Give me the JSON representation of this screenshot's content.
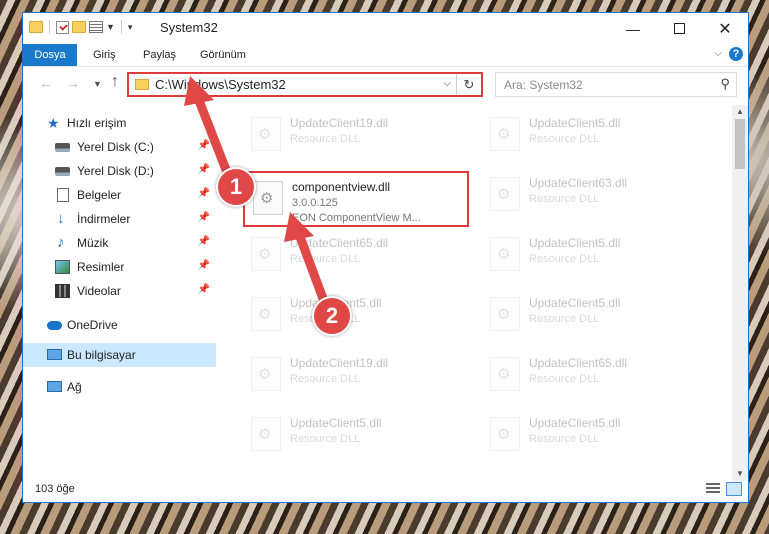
{
  "window": {
    "title": "System32",
    "minimize": "—",
    "close": "✕"
  },
  "ribbon": {
    "tabs": [
      "Dosya",
      "Giriş",
      "Paylaş",
      "Görünüm"
    ],
    "help": "?"
  },
  "navigation": {
    "address": "C:\\Windows\\System32",
    "search_placeholder": "Ara: System32"
  },
  "sidebar": {
    "items": [
      {
        "label": "Hızlı erişim",
        "icon": "star-icon",
        "pinned": false
      },
      {
        "label": "Yerel Disk (C:)",
        "icon": "drive-icon",
        "pinned": true
      },
      {
        "label": "Yerel Disk (D:)",
        "icon": "drive-icon",
        "pinned": true
      },
      {
        "label": "Belgeler",
        "icon": "document-icon",
        "pinned": true
      },
      {
        "label": "İndirmeler",
        "icon": "download-icon",
        "pinned": true
      },
      {
        "label": "Müzik",
        "icon": "music-icon",
        "pinned": true
      },
      {
        "label": "Resimler",
        "icon": "pictures-icon",
        "pinned": true
      },
      {
        "label": "Videolar",
        "icon": "videos-icon",
        "pinned": true
      },
      {
        "label": "OneDrive",
        "icon": "cloud-icon",
        "pinned": false
      },
      {
        "label": "Bu bilgisayar",
        "icon": "computer-icon",
        "pinned": false,
        "selected": true
      },
      {
        "label": "Ağ",
        "icon": "network-icon",
        "pinned": false
      }
    ]
  },
  "files": {
    "highlighted": {
      "name": "componentview.dll",
      "version": "3.0.0.125",
      "description": "EON ComponentView M..."
    },
    "left_column": [
      {
        "name": "UpdateClient19.dll",
        "desc": "Resource DLL"
      },
      {
        "name": "UpdateClient65.dll",
        "desc": "Resource DLL"
      },
      {
        "name": "UpdateClient5.dll",
        "desc": "Resource DLL"
      },
      {
        "name": "UpdateClient19.dll",
        "desc": "Resource DLL"
      },
      {
        "name": "UpdateClient5.dll",
        "desc": "Resource DLL"
      }
    ],
    "right_column": [
      {
        "name": "UpdateClient5.dll",
        "desc": "Resource DLL"
      },
      {
        "name": "UpdateClient63.dll",
        "desc": "Resource DLL"
      },
      {
        "name": "UpdateClient5.dll",
        "desc": "Resource DLL"
      },
      {
        "name": "UpdateClient5.dll",
        "desc": "Resource DLL"
      },
      {
        "name": "UpdateClient65.dll",
        "desc": "Resource DLL"
      },
      {
        "name": "UpdateClient5.dll",
        "desc": "Resource DLL"
      }
    ]
  },
  "status": {
    "item_count": "103 öğe"
  },
  "annotations": {
    "step1": "1",
    "step2": "2",
    "color": "#e04848"
  }
}
